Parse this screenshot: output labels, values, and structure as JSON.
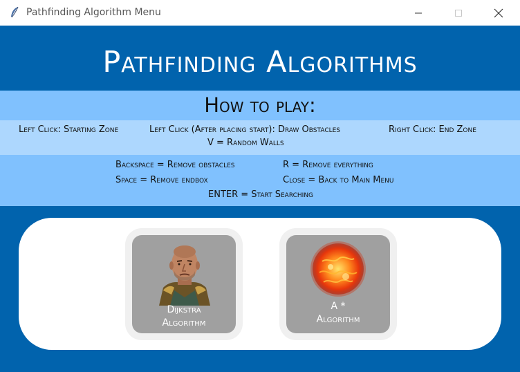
{
  "window": {
    "title": "Pathfinding Algorithm Menu",
    "app_icon": "feather-icon",
    "controls": [
      "minimize-icon",
      "maximize-icon",
      "close-icon"
    ]
  },
  "heading": "Pathfinding Algorithms",
  "how_to_play": {
    "title": "How to play:",
    "line1": [
      "Left Click: Starting Zone",
      "Left Click (After placing start): Draw Obstacles",
      "Right Click: End Zone"
    ],
    "line2": "V = Random Walls",
    "controls": [
      "Backspace = Remove obstacles",
      "R = Remove everything",
      "Space = Remove endbox",
      "Close = Back to Main Menu",
      "ENTER = Start Searching"
    ]
  },
  "algorithms": [
    {
      "line1": "Dijkstra",
      "line2": "Algorithm",
      "icon": "dijkstra-portrait"
    },
    {
      "line1": "A *",
      "line2": "Algorithm",
      "icon": "sun-icon"
    }
  ],
  "colors": {
    "window_bg": "#0163ad",
    "band_dark": "#80c1fe",
    "band_light": "#add7fe",
    "button_bg": "#a0a0a0"
  }
}
